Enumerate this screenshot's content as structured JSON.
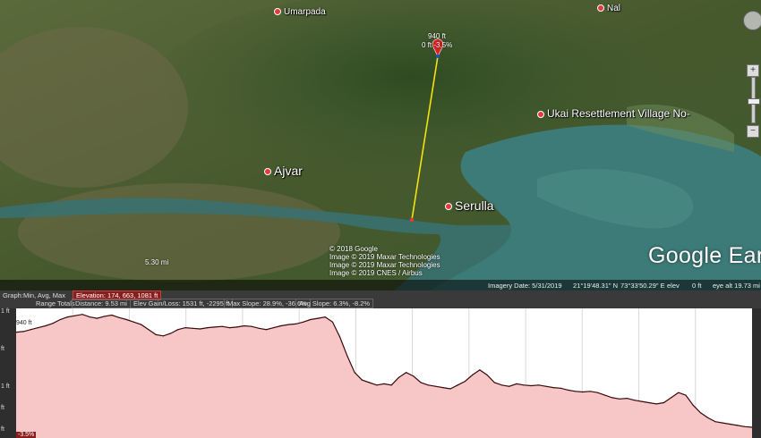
{
  "map": {
    "places": [
      {
        "name": "Umarpada",
        "size": "small"
      },
      {
        "name": "Nal",
        "size": "small"
      },
      {
        "name": "Ukai Resettlement Village No-",
        "size": "med"
      },
      {
        "name": "Ajvar",
        "size": "big"
      },
      {
        "name": "Serulla",
        "size": "big"
      }
    ],
    "path_marker_top": "940 ft",
    "path_marker_sub": "0 ft  -3.5%",
    "scale_label": "5.30 mi",
    "copyright_lines": [
      "© 2018 Google",
      "Image © 2019 Maxar Technologies",
      "Image © 2019 Maxar Technologies",
      "Image © 2019 CNES / Airbus"
    ],
    "logo": "Google Earth",
    "icons": [
      "navigation-compass-icon",
      "zoom-in-icon",
      "zoom-out-icon"
    ],
    "zoom_in_label": "+",
    "zoom_out_label": "−"
  },
  "status_bar": {
    "imagery_date": "Imagery Date: 5/31/2019",
    "lat": "21°19'48.31\" N",
    "lon": "73°33'50.29\" E",
    "elev_label": "elev",
    "elev_value": "0 ft",
    "eye_alt": "eye alt  19.73 mi"
  },
  "profile": {
    "graph_label": "Graph:",
    "graph_modes": "Min, Avg, Max",
    "elevation": "Elevation: 174, 663, 1081 ft",
    "range_totals": "Range Totals",
    "distance": "Distance: 9.53 mi",
    "elev_gain_loss": "Elev Gain/Loss: 1531 ft, -2295 ft",
    "max_slope": "Max Slope: 28.9%, -36.6%",
    "avg_slope": "Avg Slope: 6.3%, -8.2%",
    "current_point_label": "940 ft",
    "current_slope_label": "-3.5%",
    "y_axis_labels": [
      "1 ft",
      "ft",
      "1 ft",
      "ft",
      "ft"
    ],
    "colors": {
      "fill": "#f7c7c7",
      "line": "#3a0a0a",
      "background": "#ffffff",
      "accent": "#8a1c1c"
    }
  },
  "chart_data": {
    "type": "area",
    "x": [
      0,
      1,
      2,
      3,
      4,
      5,
      6,
      7,
      8,
      9,
      10,
      11,
      12,
      13,
      14,
      15,
      16,
      17,
      18,
      19,
      20,
      21,
      22,
      23,
      24,
      25,
      26,
      27,
      28,
      29,
      30,
      31,
      32,
      33,
      34,
      35,
      36,
      37,
      38,
      39,
      40,
      41,
      42,
      43,
      44,
      45,
      46,
      47,
      48,
      49,
      50,
      51,
      52,
      53,
      54,
      55,
      56,
      57,
      58,
      59,
      60,
      61,
      62,
      63,
      64,
      65,
      66,
      67,
      68,
      69,
      70,
      71,
      72,
      73,
      74,
      75,
      76,
      77,
      78,
      79,
      80,
      81,
      82,
      83,
      84,
      85,
      86,
      87,
      88,
      89,
      90,
      91,
      92,
      93,
      94,
      95,
      96,
      97,
      98,
      99,
      100
    ],
    "y": [
      940,
      945,
      960,
      975,
      990,
      1010,
      1040,
      1060,
      1070,
      1081,
      1060,
      1050,
      1065,
      1075,
      1055,
      1040,
      1020,
      1000,
      960,
      920,
      910,
      930,
      960,
      975,
      970,
      965,
      975,
      980,
      985,
      975,
      980,
      990,
      985,
      970,
      960,
      975,
      990,
      1000,
      1005,
      1020,
      1040,
      1050,
      1060,
      1020,
      900,
      750,
      620,
      560,
      540,
      520,
      530,
      520,
      580,
      620,
      590,
      540,
      520,
      510,
      500,
      490,
      520,
      550,
      600,
      640,
      600,
      540,
      520,
      510,
      530,
      520,
      515,
      520,
      510,
      500,
      495,
      480,
      470,
      465,
      470,
      460,
      440,
      420,
      410,
      415,
      400,
      390,
      380,
      370,
      380,
      420,
      460,
      440,
      360,
      300,
      260,
      230,
      220,
      210,
      200,
      190,
      185
    ]
  }
}
